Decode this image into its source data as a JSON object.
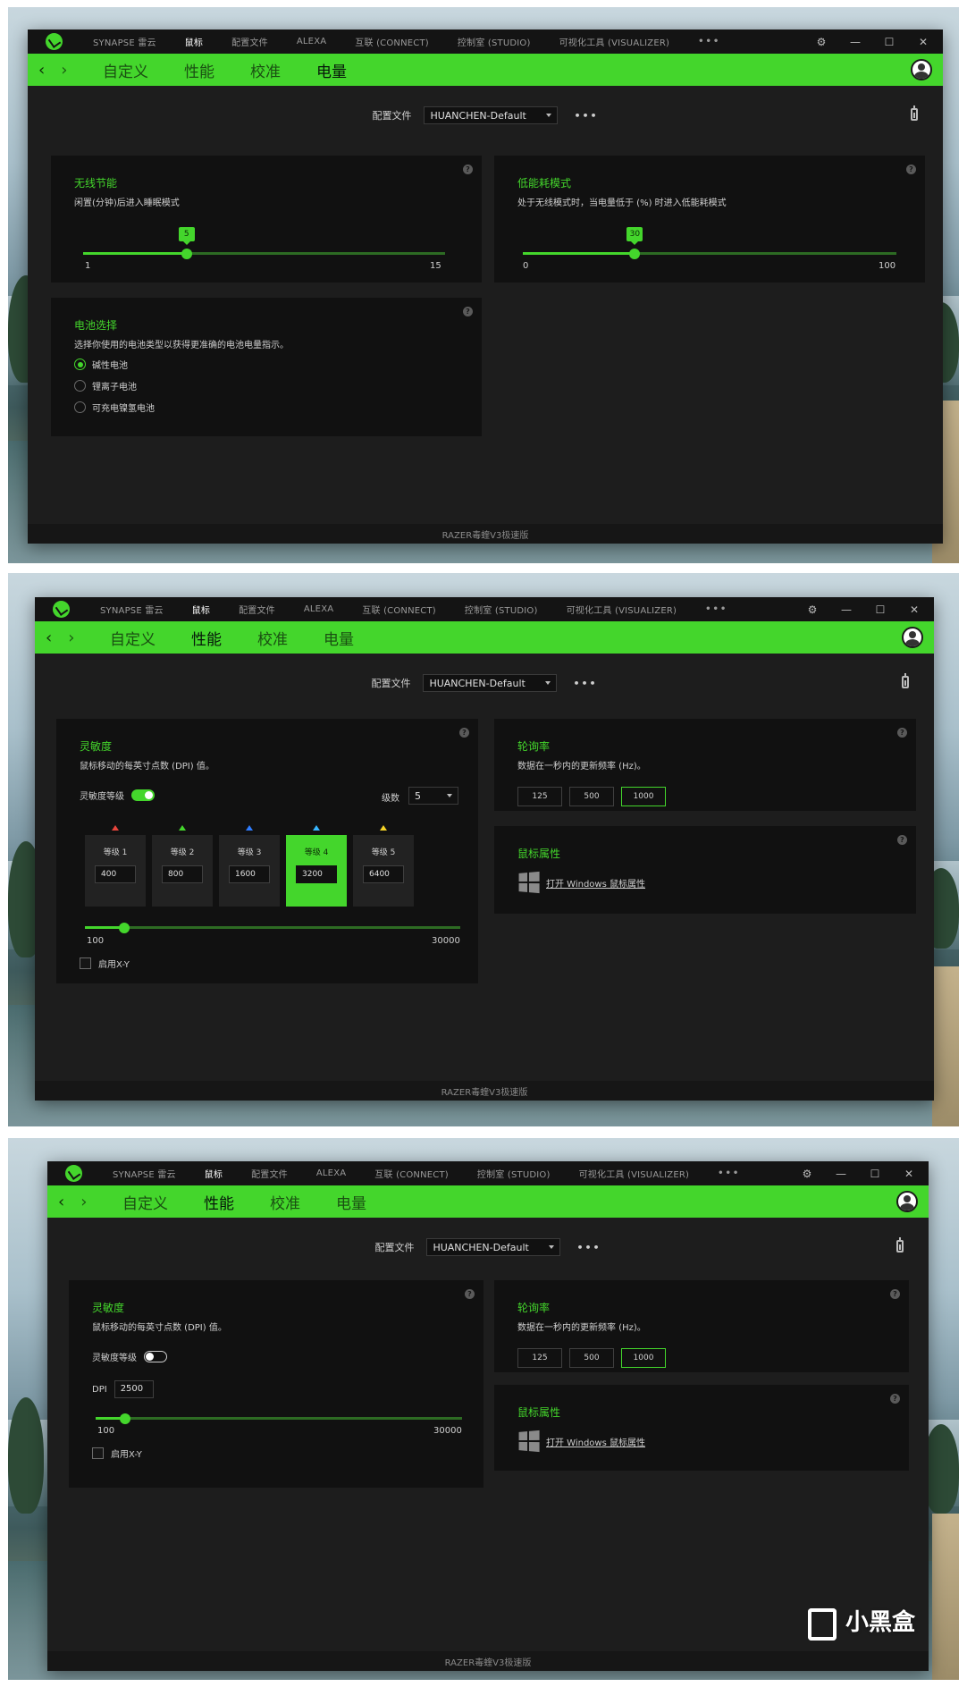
{
  "app": {
    "top_nav": [
      "SYNAPSE 雷云",
      "鼠标",
      "配置文件",
      "ALEXA",
      "互联 (CONNECT)",
      "控制室 (STUDIO)",
      "可视化工具 (VISUALIZER)"
    ],
    "active_nav": "鼠标",
    "more": "•••",
    "window_controls": [
      "⚙",
      "—",
      "☐",
      "✕"
    ],
    "arrows": [
      "‹",
      "›"
    ],
    "sub_tabs": [
      "自定义",
      "性能",
      "校准",
      "电量"
    ],
    "profile_label": "配置文件",
    "profile_value": "HUANCHEN-Default",
    "profile_more": "•••",
    "device_name": "RAZER毒蝰V3极速版",
    "help_glyph": "?"
  },
  "screen1": {
    "active_tab": "电量",
    "wireless_saving": {
      "title": "无线节能",
      "desc": "闲置(分钟)后进入睡眠模式",
      "min": "1",
      "max": "15",
      "value": 5,
      "range": [
        1,
        15
      ]
    },
    "low_power": {
      "title": "低能耗模式",
      "desc": "处于无线模式时，当电量低于 (%) 时进入低能耗模式",
      "min": "0",
      "max": "100",
      "value": 30,
      "range": [
        0,
        100
      ]
    },
    "battery": {
      "title": "电池选择",
      "desc": "选择你使用的电池类型以获得更准确的电池电量指示。",
      "options": [
        "碱性电池",
        "锂离子电池",
        "可充电镍氢电池"
      ],
      "selected": 0
    }
  },
  "screen2": {
    "active_tab": "性能",
    "sensitivity": {
      "title": "灵敏度",
      "desc": "鼠标移动的每英寸点数 (DPI) 值。",
      "stages_label": "灵敏度等级",
      "stages_on": true,
      "levels_label": "级数",
      "levels_value": "5",
      "stages": [
        {
          "name": "等级 1",
          "value": "400",
          "color": "#e8453c"
        },
        {
          "name": "等级 2",
          "value": "800",
          "color": "#44d62c"
        },
        {
          "name": "等级 3",
          "value": "1600",
          "color": "#2f7dff"
        },
        {
          "name": "等级 4",
          "value": "3200",
          "color": "#38b6ff"
        },
        {
          "name": "等级 5",
          "value": "6400",
          "color": "#f5d327"
        }
      ],
      "active_stage": 3,
      "min": "100",
      "max": "30000",
      "slider_value": 3200,
      "range": [
        100,
        30000
      ],
      "xy_label": "启用X-Y"
    },
    "polling": {
      "title": "轮询率",
      "desc": "数据在一秒内的更新频率 (Hz)。",
      "rates": [
        "125",
        "500",
        "1000"
      ],
      "selected": "1000"
    },
    "mouse_props": {
      "title": "鼠标属性",
      "link": "打开 Windows 鼠标属性"
    }
  },
  "screen3": {
    "active_tab": "性能",
    "sensitivity": {
      "title": "灵敏度",
      "desc": "鼠标移动的每英寸点数 (DPI) 值。",
      "stages_label": "灵敏度等级",
      "stages_on": false,
      "dpi_label": "DPI",
      "dpi_value": "2500",
      "min": "100",
      "max": "30000",
      "slider_value": 2500,
      "range": [
        100,
        30000
      ],
      "xy_label": "启用X-Y"
    },
    "polling": {
      "title": "轮询率",
      "desc": "数据在一秒内的更新频率 (Hz)。",
      "rates": [
        "125",
        "500",
        "1000"
      ],
      "selected": "1000"
    },
    "mouse_props": {
      "title": "鼠标属性",
      "link": "打开 Windows 鼠标属性"
    }
  },
  "watermark": "小黑盒",
  "colors": {
    "accent": "#44d62c",
    "panel": "#111111",
    "window": "#1d1d1d"
  }
}
